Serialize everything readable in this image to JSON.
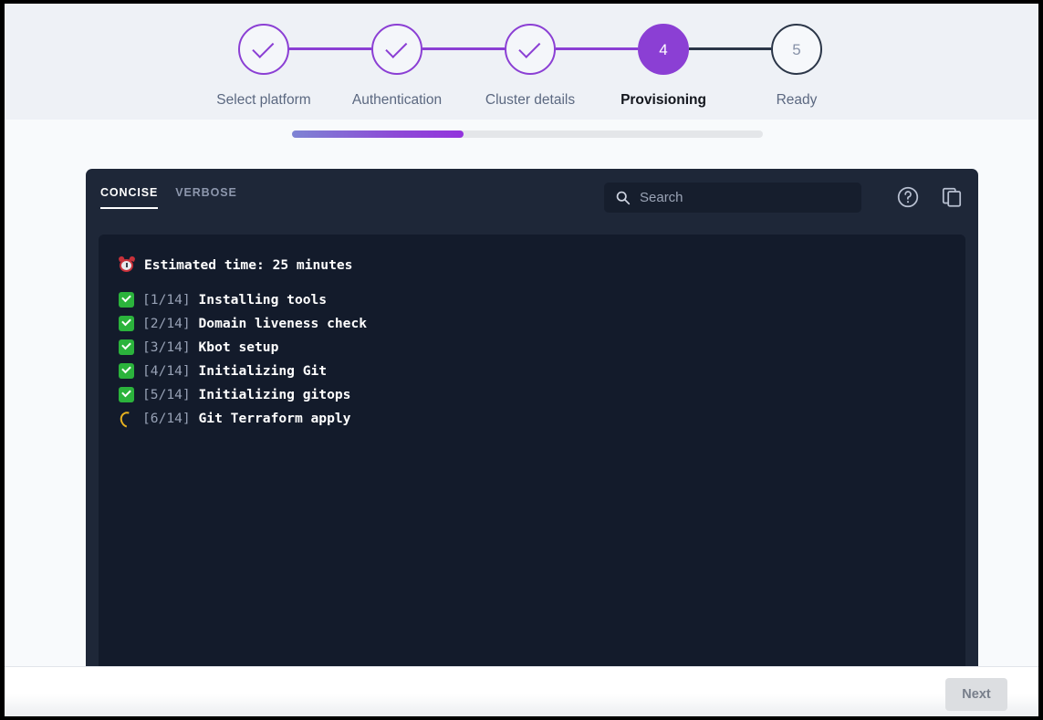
{
  "stepper": {
    "steps": [
      {
        "label": "Select platform",
        "state": "done",
        "marker": "check"
      },
      {
        "label": "Authentication",
        "state": "done",
        "marker": "check"
      },
      {
        "label": "Cluster details",
        "state": "done",
        "marker": "check"
      },
      {
        "label": "Provisioning",
        "state": "current",
        "marker": "4"
      },
      {
        "label": "Ready",
        "state": "pending",
        "marker": "5"
      }
    ],
    "accent_color": "#8b3fd4",
    "pending_color": "#2b3648"
  },
  "progress": {
    "percent": 36.5,
    "gradient_from": "#7e84d4",
    "gradient_to": "#9333dd",
    "track_color": "#e4e6e9"
  },
  "console": {
    "tabs": [
      {
        "label": "CONCISE",
        "active": true
      },
      {
        "label": "VERBOSE",
        "active": false
      }
    ],
    "search": {
      "placeholder": "Search",
      "value": "",
      "icon": "search-icon"
    },
    "tools": [
      {
        "name": "help-icon",
        "title": "Help"
      },
      {
        "name": "copy-icon",
        "title": "Copy"
      }
    ],
    "log": {
      "heading": "Estimated time: 25 minutes",
      "heading_icon": "alarm-clock-icon",
      "lines": [
        {
          "icon": "green-check-icon",
          "counter": "[1/14]",
          "text": "Installing tools"
        },
        {
          "icon": "green-check-icon",
          "counter": "[2/14]",
          "text": "Domain liveness check"
        },
        {
          "icon": "green-check-icon",
          "counter": "[3/14]",
          "text": "Kbot setup"
        },
        {
          "icon": "green-check-icon",
          "counter": "[4/14]",
          "text": "Initializing Git"
        },
        {
          "icon": "green-check-icon",
          "counter": "[5/14]",
          "text": "Initializing gitops"
        },
        {
          "icon": "spinner-icon",
          "counter": "[6/14]",
          "text": "Git Terraform apply"
        }
      ]
    }
  },
  "footer": {
    "next_label": "Next",
    "next_disabled": true
  }
}
